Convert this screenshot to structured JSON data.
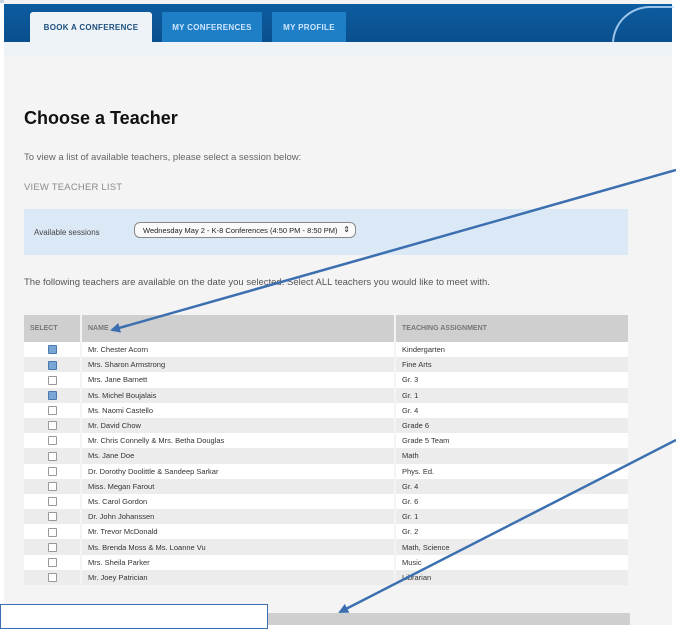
{
  "nav": {
    "tabs": [
      {
        "label": "BOOK A CONFERENCE"
      },
      {
        "label": "MY CONFERENCES"
      },
      {
        "label": "MY PROFILE"
      }
    ]
  },
  "page": {
    "title": "Choose a Teacher",
    "prompt": "To view a list of available teachers, please select a session below:",
    "view_link": "VIEW TEACHER LIST",
    "session_label": "Available sessions",
    "session_value": "Wednesday May 2 - K-8 Conferences (4:50 PM - 8:50 PM)",
    "availability_text": "The following teachers are available on the date you selected. Select ALL teachers you would like to meet with."
  },
  "table": {
    "headers": [
      "SELECT",
      "NAME",
      "TEACHING ASSIGNMENT"
    ],
    "rows": [
      {
        "name": "Mr. Chester Acorn",
        "assignment": "Kindergarten",
        "checked": true
      },
      {
        "name": "Mrs. Sharon Armstrong",
        "assignment": "Fine Arts",
        "checked": true
      },
      {
        "name": "Mrs. Jane Barnett",
        "assignment": "Gr. 3",
        "checked": false
      },
      {
        "name": "Ms. Michel Boujalais",
        "assignment": "Gr. 1",
        "checked": true
      },
      {
        "name": "Ms. Naomi Castello",
        "assignment": "Gr. 4",
        "checked": false
      },
      {
        "name": "Mr. David Chow",
        "assignment": "Grade 6",
        "checked": false
      },
      {
        "name": "Mr. Chris Connelly & Mrs. Betha Douglas",
        "assignment": "Grade 5 Team",
        "checked": false
      },
      {
        "name": "Ms. Jane Doe",
        "assignment": "Math",
        "checked": false
      },
      {
        "name": "Dr. Dorothy Doolittle & Sandeep Sarkar",
        "assignment": "Phys. Ed.",
        "checked": false
      },
      {
        "name": "Miss. Megan Farout",
        "assignment": "Gr. 4",
        "checked": false
      },
      {
        "name": "Ms. Carol Gordon",
        "assignment": "Gr. 6",
        "checked": false
      },
      {
        "name": "Dr. John Johanssen",
        "assignment": "Gr. 1",
        "checked": false
      },
      {
        "name": "Mr. Trevor McDonald",
        "assignment": "Gr. 2",
        "checked": false
      },
      {
        "name": "Ms. Brenda Moss & Ms. Loanne Vu",
        "assignment": "Math, Science",
        "checked": false
      },
      {
        "name": "Mrs. Sheila Parker",
        "assignment": "Music",
        "checked": false
      },
      {
        "name": "Mr. Joey Patrician",
        "assignment": "Librarian",
        "checked": false
      }
    ]
  },
  "colors": {
    "nav": "#0a4f8e",
    "session_box": "#dbe8f6",
    "arrow": "#3b6fb0"
  }
}
